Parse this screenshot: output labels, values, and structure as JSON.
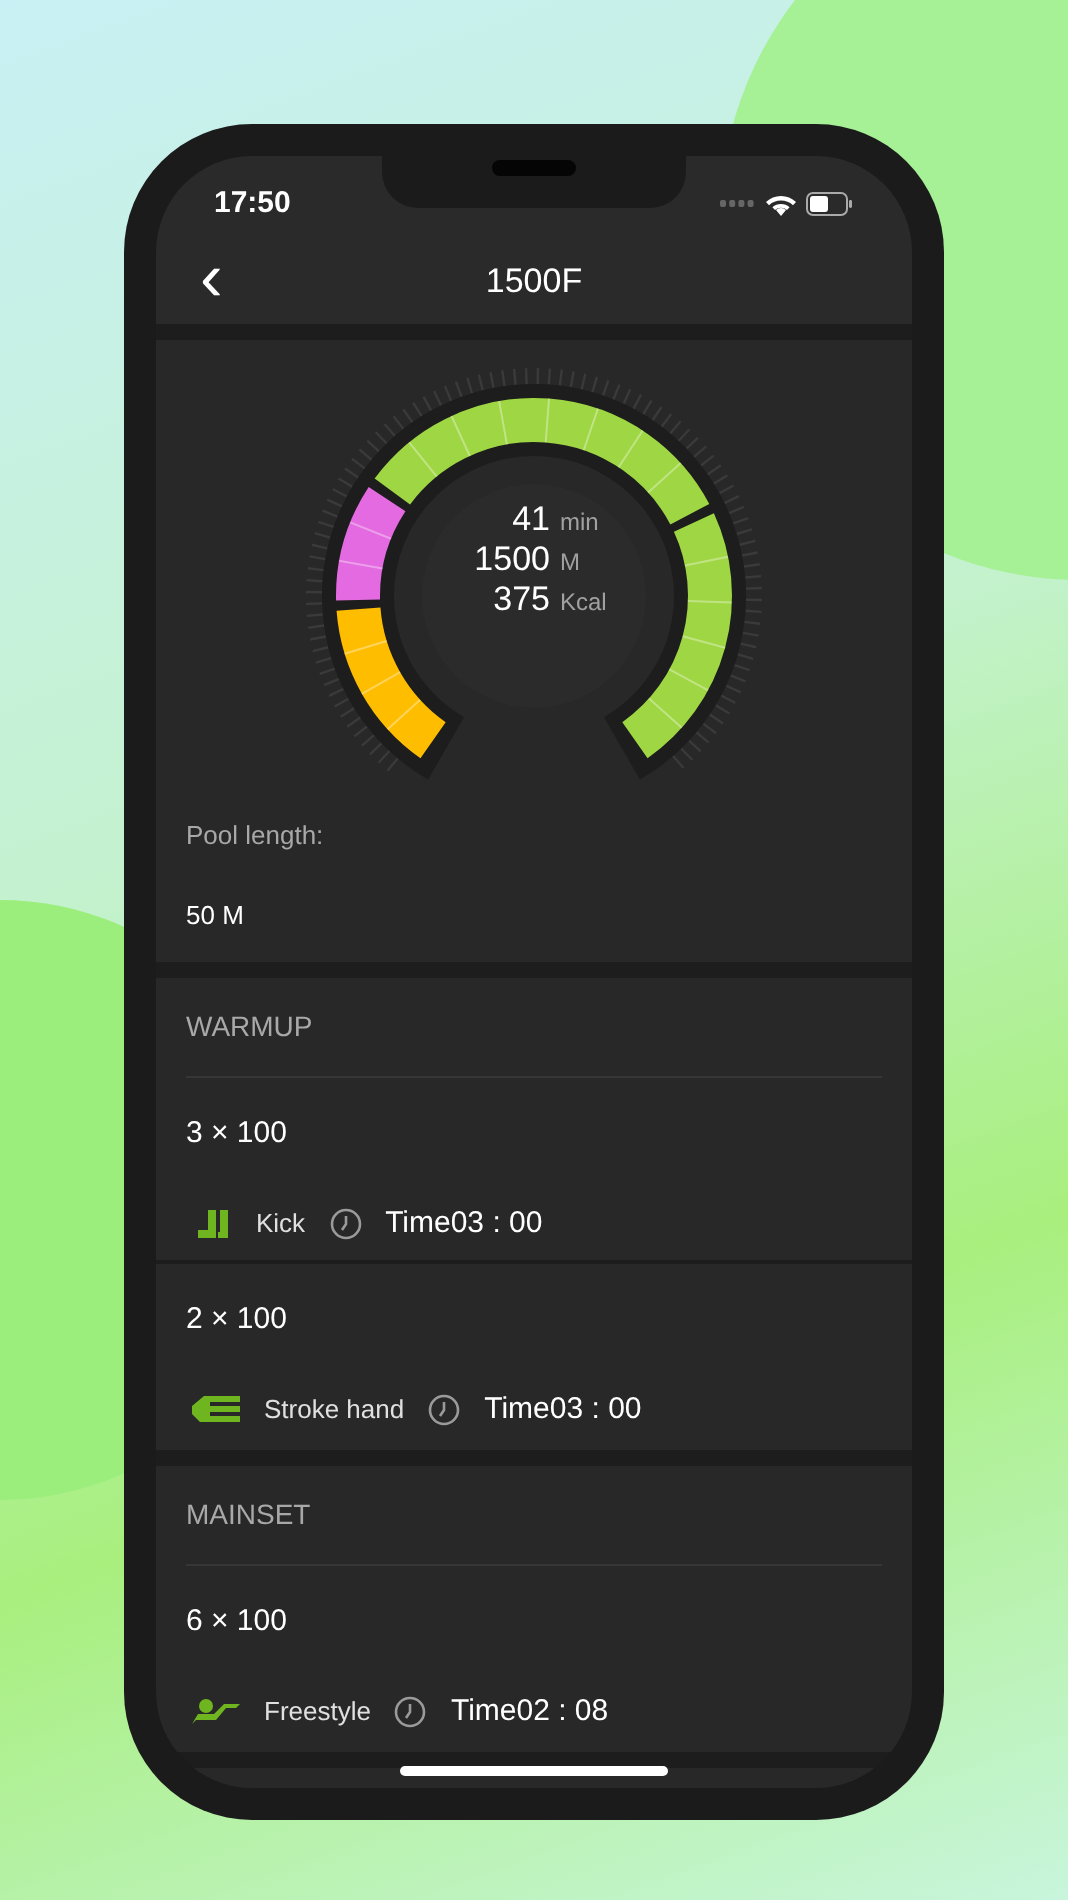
{
  "status_bar": {
    "time": "17:50"
  },
  "nav": {
    "back": "‹",
    "title": "1500F"
  },
  "gauge": {
    "segments": [
      {
        "color": "#ffbd00"
      },
      {
        "color": "#e36ae0"
      },
      {
        "color": "#9fd643"
      },
      {
        "color": "#9fd643"
      }
    ],
    "stats": [
      {
        "value": "41",
        "unit": "min"
      },
      {
        "value": "1500",
        "unit": "M"
      },
      {
        "value": "375",
        "unit": "Kcal"
      }
    ]
  },
  "pool": {
    "label": "Pool length:",
    "value": "50 M"
  },
  "sections": [
    {
      "title": "WARMUP",
      "items": [
        {
          "sets": "3 × 100",
          "kind": "kick",
          "stroke": "Kick",
          "time": "Time03 : 00"
        },
        {
          "sets": "2 × 100",
          "kind": "hand",
          "stroke": "Stroke hand",
          "time": "Time03 : 00"
        }
      ]
    },
    {
      "title": "MAINSET",
      "items": [
        {
          "sets": "6 × 100",
          "kind": "freestyle",
          "stroke": "Freestyle",
          "time": "Time02 : 08"
        }
      ]
    }
  ]
}
